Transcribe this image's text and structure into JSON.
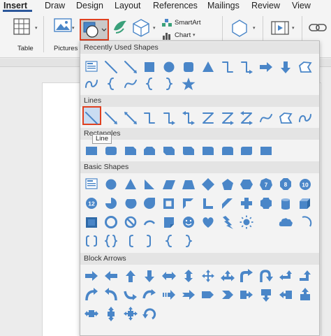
{
  "menu": {
    "tabs": [
      "Insert",
      "Draw",
      "Design",
      "Layout",
      "References",
      "Mailings",
      "Review",
      "View"
    ]
  },
  "ribbon": {
    "table_label": "Table",
    "pictures_label": "Pictures",
    "smartart_label": "SmartArt",
    "chart_label": "Chart"
  },
  "dropdown": {
    "categories": [
      "Recently Used Shapes",
      "Lines",
      "Rectangles",
      "Basic Shapes",
      "Block Arrows"
    ],
    "tooltip": "Line"
  },
  "colors": {
    "accent": "#4a86c8",
    "highlight_border": "#e0401f",
    "tab_underline": "#2b579a"
  }
}
